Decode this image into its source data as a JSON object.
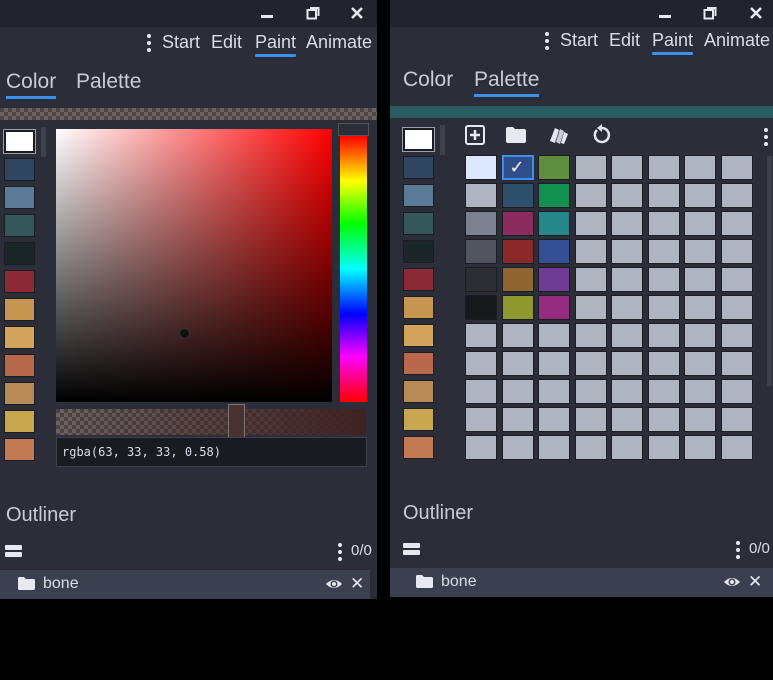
{
  "window": {
    "minimize_icon": "minimize-icon",
    "restore_icon": "restore-icon",
    "close_icon": "close-icon"
  },
  "menu": {
    "items": [
      "Start",
      "Edit",
      "Paint",
      "Animate"
    ],
    "active": "Paint"
  },
  "panels": {
    "left": {
      "tabs": [
        "Color",
        "Palette"
      ],
      "active_tab": "Color"
    },
    "right": {
      "tabs": [
        "Color",
        "Palette"
      ],
      "active_tab": "Palette"
    }
  },
  "color_picker": {
    "value": "rgba(63, 33, 33, 0.58)",
    "hue_color": "#ff0000"
  },
  "recent_swatches": [
    "#ffffff",
    "#2f4560",
    "#5b7a96",
    "#345859",
    "#1a2627",
    "#8b2a36",
    "#c79752",
    "#d4a35c",
    "#b8694b",
    "#b88a57",
    "#c8a750",
    "#c27a55"
  ],
  "palette": {
    "tools": [
      "add-icon",
      "folder-icon",
      "sort-icon",
      "reset-icon"
    ],
    "columns": 8,
    "selected_index": 1,
    "colors": [
      "#dbe8ff",
      "#2f4d88",
      "#5f8f3e",
      "#aeb5c0",
      "#aeb5c0",
      "#aeb5c0",
      "#aeb5c0",
      "#aeb5c0",
      "#aeb5c0",
      "#2d4f6b",
      "#129151",
      "#aeb5c0",
      "#aeb5c0",
      "#aeb5c0",
      "#aeb5c0",
      "#aeb5c0",
      "#7b8190",
      "#8c2b5f",
      "#25878a",
      "#aeb5c0",
      "#aeb5c0",
      "#aeb5c0",
      "#aeb5c0",
      "#aeb5c0",
      "#51555f",
      "#8b2929",
      "#344f93",
      "#aeb5c0",
      "#aeb5c0",
      "#aeb5c0",
      "#aeb5c0",
      "#aeb5c0",
      "#2c2e33",
      "#8f6530",
      "#6e3a92",
      "#aeb5c0",
      "#aeb5c0",
      "#aeb5c0",
      "#aeb5c0",
      "#aeb5c0",
      "#17181b",
      "#8e9a30",
      "#942d80",
      "#aeb5c0",
      "#aeb5c0",
      "#aeb5c0",
      "#aeb5c0",
      "#aeb5c0",
      "#aeb5c0",
      "#aeb5c0",
      "#aeb5c0",
      "#aeb5c0",
      "#aeb5c0",
      "#aeb5c0",
      "#aeb5c0",
      "#aeb5c0",
      "#aeb5c0",
      "#aeb5c0",
      "#aeb5c0",
      "#aeb5c0",
      "#aeb5c0",
      "#aeb5c0",
      "#aeb5c0",
      "#aeb5c0",
      "#aeb5c0",
      "#aeb5c0",
      "#aeb5c0",
      "#aeb5c0",
      "#aeb5c0",
      "#aeb5c0",
      "#aeb5c0",
      "#aeb5c0",
      "#aeb5c0",
      "#aeb5c0",
      "#aeb5c0",
      "#aeb5c0",
      "#aeb5c0",
      "#aeb5c0",
      "#aeb5c0",
      "#aeb5c0",
      "#aeb5c0",
      "#aeb5c0",
      "#aeb5c0",
      "#aeb5c0",
      "#aeb5c0",
      "#aeb5c0",
      "#aeb5c0",
      "#aeb5c0"
    ]
  },
  "outliner": {
    "title": "Outliner",
    "count": "0/0",
    "items": [
      {
        "label": "bone"
      }
    ]
  },
  "colors": {
    "accent": "#3c8ef0",
    "panel_bg": "#2b2e38",
    "row_bg": "#3b4050"
  }
}
